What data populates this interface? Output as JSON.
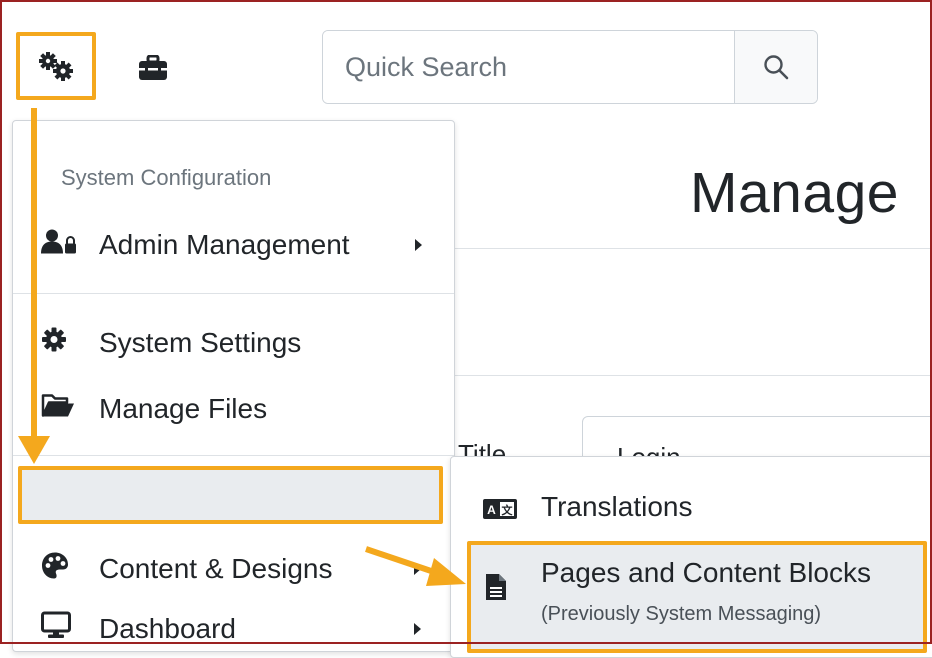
{
  "topbar": {
    "search_placeholder": "Quick Search",
    "icons": {
      "settings": "gears-icon",
      "tools": "toolbox-icon",
      "search": "search-icon"
    }
  },
  "page": {
    "title": "Manage",
    "field_label": "Title",
    "field_value": "Login"
  },
  "menu": {
    "header": "System Configuration",
    "items": [
      {
        "label": "Admin Management",
        "icon": "user-lock-icon",
        "has_submenu": true
      },
      {
        "label": "System Settings",
        "icon": "cog-icon",
        "has_submenu": false
      },
      {
        "label": "Manage Files",
        "icon": "folder-open-icon",
        "has_submenu": false
      },
      {
        "label": "Content & Designs",
        "icon": "palette-icon",
        "has_submenu": true,
        "highlighted": true
      },
      {
        "label": "Dashboard",
        "icon": "desktop-icon",
        "has_submenu": true
      }
    ]
  },
  "submenu": {
    "items": [
      {
        "label": "Translations",
        "icon": "language-icon"
      },
      {
        "label": "Pages and Content Blocks",
        "sublabel": "(Previously System Messaging)",
        "icon": "file-icon",
        "highlighted": true
      }
    ]
  },
  "colors": {
    "highlight": "#f4a81d",
    "frame": "#9b2222",
    "hover_bg": "#e9ecef"
  }
}
